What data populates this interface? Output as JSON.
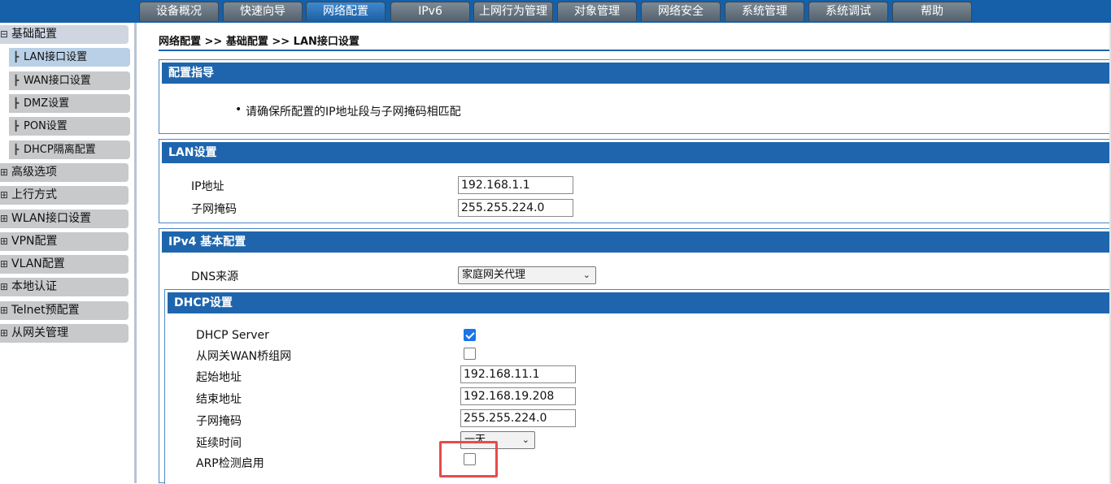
{
  "nav_tabs": [
    {
      "label": "设备概况",
      "active": false
    },
    {
      "label": "快速向导",
      "active": false
    },
    {
      "label": "网络配置",
      "active": true
    },
    {
      "label": "IPv6",
      "active": false
    },
    {
      "label": "上网行为管理",
      "active": false
    },
    {
      "label": "对象管理",
      "active": false
    },
    {
      "label": "网络安全",
      "active": false
    },
    {
      "label": "系统管理",
      "active": false
    },
    {
      "label": "系统调试",
      "active": false
    },
    {
      "label": "帮助",
      "active": false
    }
  ],
  "sidebar": {
    "expanded_glyph": "⊟",
    "collapsed_glyph": "⊞",
    "sub_glyph": "┣",
    "groups": [
      {
        "label": "基础配置",
        "expanded": true,
        "items": [
          {
            "label": "LAN接口设置",
            "active": true
          },
          {
            "label": "WAN接口设置",
            "active": false
          },
          {
            "label": "DMZ设置",
            "active": false
          },
          {
            "label": "PON设置",
            "active": false
          },
          {
            "label": "DHCP隔离配置",
            "active": false
          }
        ]
      },
      {
        "label": "高级选项",
        "expanded": false
      },
      {
        "label": "上行方式",
        "expanded": false
      },
      {
        "label": "WLAN接口设置",
        "expanded": false
      },
      {
        "label": "VPN配置",
        "expanded": false
      },
      {
        "label": "VLAN配置",
        "expanded": false
      },
      {
        "label": "本地认证",
        "expanded": false
      },
      {
        "label": "Telnet预配置",
        "expanded": false
      },
      {
        "label": "从网关管理",
        "expanded": false
      }
    ]
  },
  "breadcrumb": "网络配置 >> 基础配置 >> LAN接口设置",
  "guide": {
    "title": "配置指导",
    "bullet": "•",
    "text": "请确保所配置的IP地址段与子网掩码相匹配"
  },
  "lan": {
    "title": "LAN设置",
    "ip_label": "IP地址",
    "ip_value": "192.168.1.1",
    "mask_label": "子网掩码",
    "mask_value": "255.255.224.0"
  },
  "ipv4": {
    "title": "IPv4 基本配置",
    "dns_label": "DNS来源",
    "dns_value": "家庭网关代理"
  },
  "dhcp": {
    "title": "DHCP设置",
    "server_label": "DHCP Server",
    "server_checked": true,
    "bridge_label": "从网关WAN桥组网",
    "bridge_checked": false,
    "start_label": "起始地址",
    "start_value": "192.168.11.1",
    "end_label": "结束地址",
    "end_value": "192.168.19.208",
    "mask_label": "子网掩码",
    "mask_value": "255.255.224.0",
    "lease_label": "延续时间",
    "lease_value": "一天",
    "arp_label": "ARP检测启用",
    "arp_checked": false
  },
  "colors": {
    "header_blue": "#1f65ad",
    "active_tab": "#2f7bc4",
    "tab_grey": "#6a7784",
    "highlight_red": "#e84b4b",
    "checkbox_blue": "#1a73e8"
  }
}
